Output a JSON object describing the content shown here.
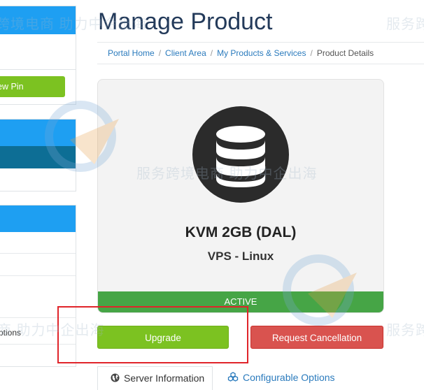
{
  "header": {
    "title": "Manage Product"
  },
  "breadcrumb": {
    "items": [
      "Portal Home",
      "Client Area",
      "My Products & Services"
    ],
    "separator": "/",
    "current": "Product Details"
  },
  "sidebar": {
    "pin_button_label": "ew Pin",
    "options_label": "ptions"
  },
  "product": {
    "name": "KVM 2GB (DAL)",
    "group": "VPS - Linux",
    "status": "ACTIVE",
    "icon": "database-icon"
  },
  "actions": {
    "upgrade_label": "Upgrade",
    "cancel_label": "Request Cancellation"
  },
  "tabs": [
    {
      "label": "Server Information",
      "icon": "globe-icon"
    },
    {
      "label": "Configurable Options",
      "icon": "cubes-icon"
    }
  ],
  "watermark": {
    "subtitle": "服务跨境电商 助力中企出海",
    "subtitle_short": "服务跨",
    "fragment_a": "跨境电商 助力中企出海",
    "fragment_b": "商 助力中企出海",
    "fragment_c": "服务跨境电商 助力中企出海",
    "fragment_d": "服务跨"
  },
  "colors": {
    "accent_blue": "#1e9ff2",
    "title_navy": "#233a5a",
    "success_green": "#7cc221",
    "status_green": "#46a546",
    "danger_red": "#d9534f",
    "highlight_red": "#e0242a"
  }
}
